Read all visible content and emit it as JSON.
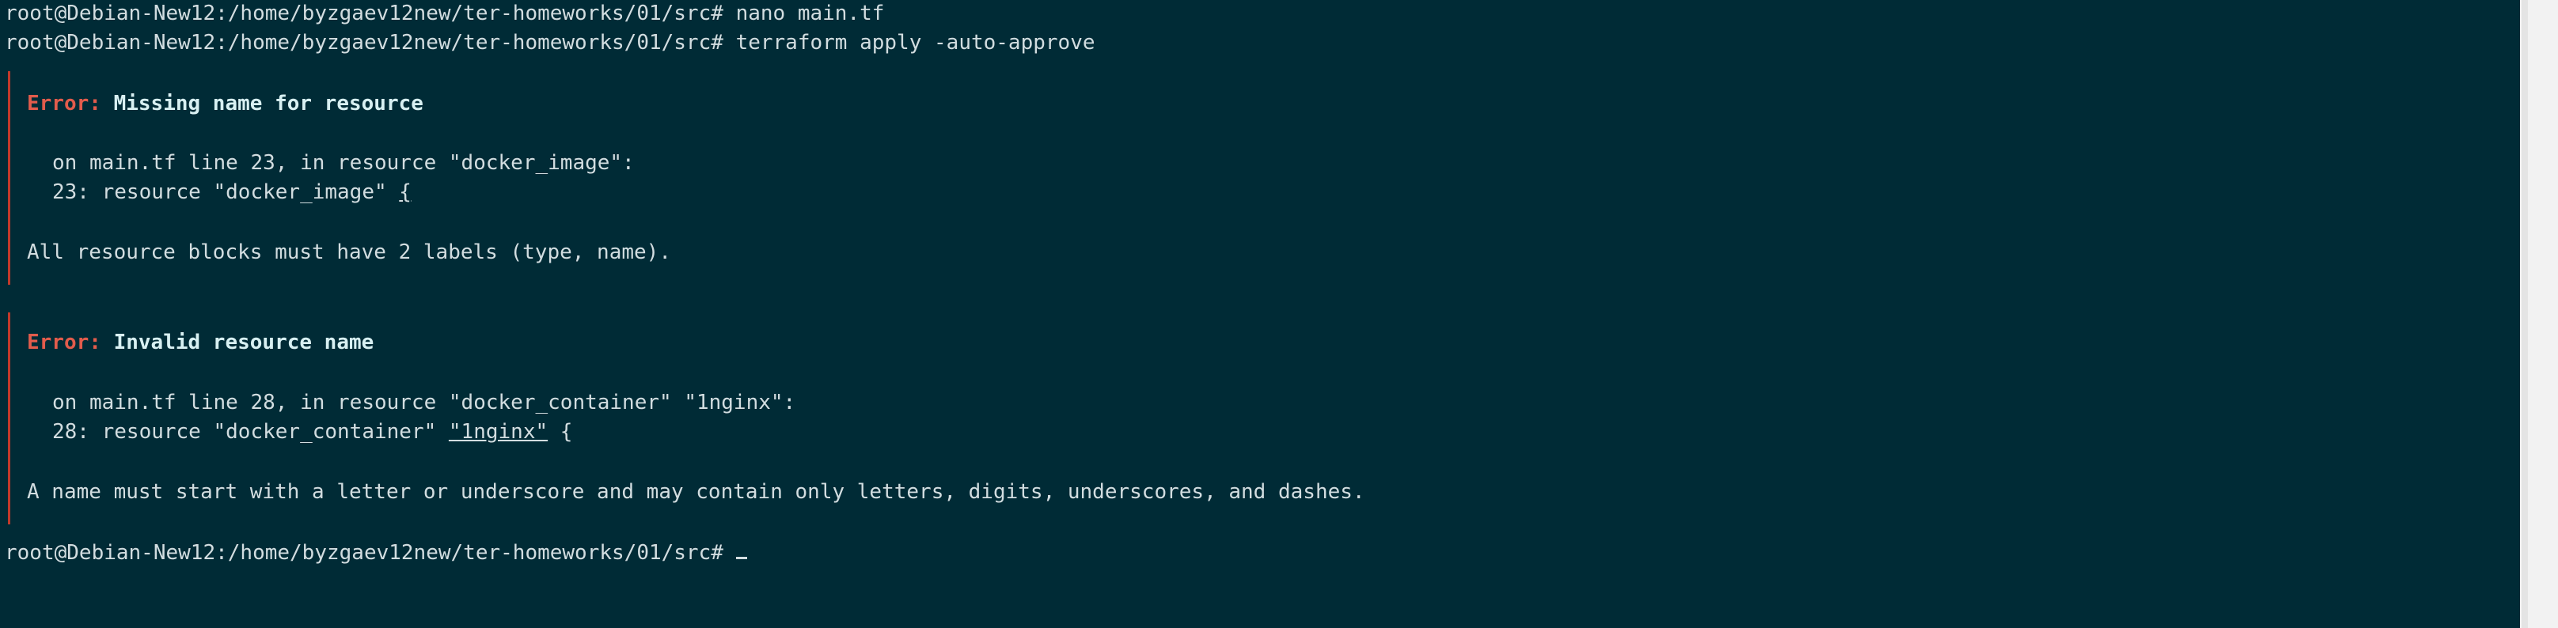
{
  "terminal": {
    "prompt": "root@Debian-New12:/home/byzgaev12new/ter-homeworks/01/src#",
    "commands": [
      "nano main.tf",
      "terraform apply -auto-approve",
      ""
    ],
    "errors": [
      {
        "label": "Error:",
        "summary": "Missing name for resource",
        "location": "on main.tf line 23, in resource \"docker_image\":",
        "code_prefix": "23: resource \"docker_image\" ",
        "code_highlight": "{",
        "code_suffix": "",
        "detail": "All resource blocks must have 2 labels (type, name)."
      },
      {
        "label": "Error:",
        "summary": "Invalid resource name",
        "location": "on main.tf line 28, in resource \"docker_container\" \"1nginx\":",
        "code_prefix": "28: resource \"docker_container\" ",
        "code_highlight": "\"1nginx\"",
        "code_suffix": " {",
        "detail": "A name must start with a letter or underscore and may contain only letters, digits, underscores, and dashes."
      }
    ]
  },
  "colors": {
    "background": "#002b36",
    "text": "#d2dde0",
    "error": "#e25c4c",
    "error_bar": "#c0392b",
    "scrollbar": "#f2f2f2"
  }
}
